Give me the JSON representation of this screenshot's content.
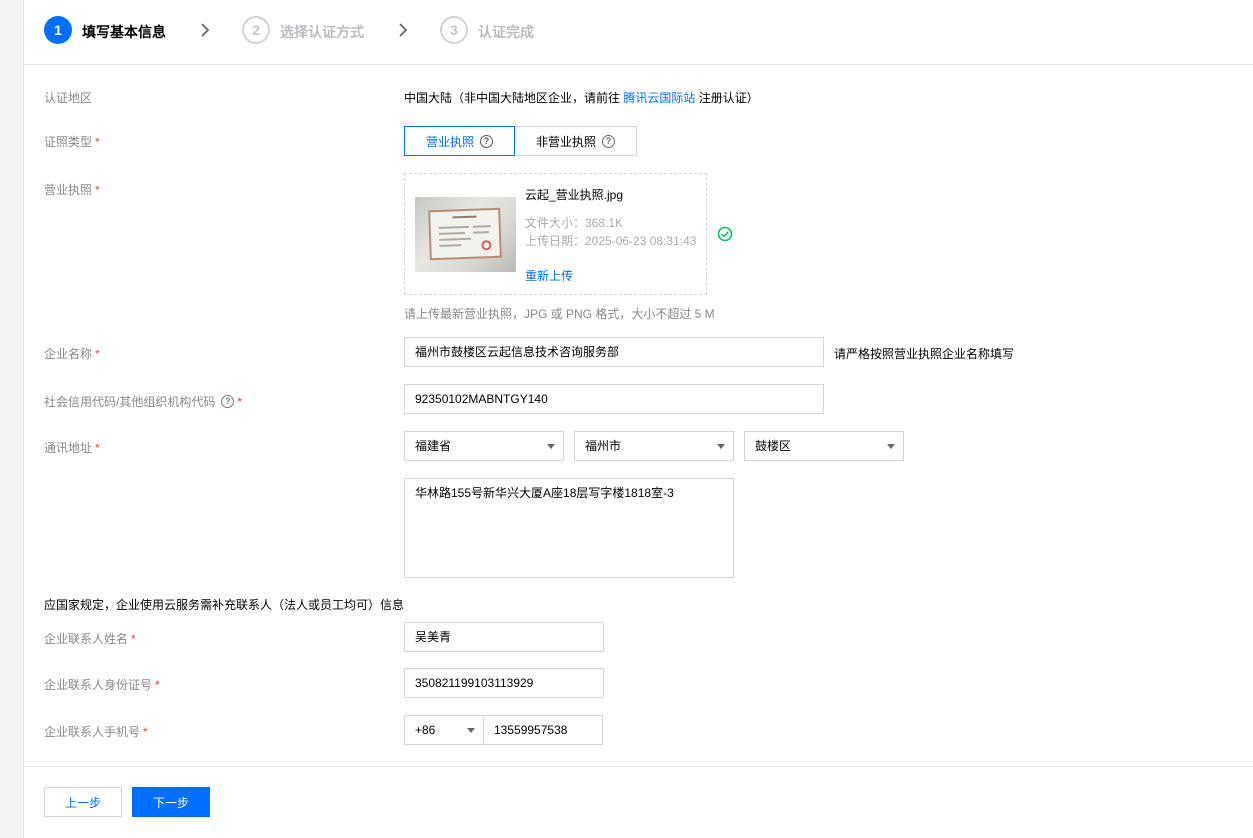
{
  "steps": [
    {
      "num": "1",
      "label": "填写基本信息"
    },
    {
      "num": "2",
      "label": "选择认证方式"
    },
    {
      "num": "3",
      "label": "认证完成"
    }
  ],
  "region": {
    "label": "认证地区",
    "prefix": "中国大陆（非中国大陆地区企业，请前往 ",
    "link": "腾讯云国际站",
    "suffix": " 注册认证）"
  },
  "license_type": {
    "label": "证照类型",
    "required": "*",
    "options": [
      "营业执照",
      "非营业执照"
    ],
    "help_icon": "?"
  },
  "license": {
    "label": "营业执照",
    "required": "*",
    "file_name": "云起_营业执照.jpg",
    "file_size": "文件大小：368.1K",
    "upload_date": "上传日期：2025-06-23 08:31:43",
    "reupload": "重新上传",
    "hint": "请上传最新营业执照，JPG 或 PNG 格式，大小不超过 5 M"
  },
  "company_name": {
    "label": "企业名称",
    "required": "*",
    "value": "福州市鼓楼区云起信息技术咨询服务部",
    "hint": "请严格按照营业执照企业名称填写"
  },
  "credit_code": {
    "label": "社会信用代码/其他组织机构代码",
    "required": "*",
    "value": "92350102MABNTGY140"
  },
  "address": {
    "label": "通讯地址",
    "required": "*",
    "province": "福建省",
    "city": "福州市",
    "district": "鼓楼区",
    "detail": "华林路155号新华兴大厦A座18层写字楼1818室-3"
  },
  "contact_notice": "应国家规定，企业使用云服务需补充联系人（法人或员工均可）信息",
  "contact": {
    "name_label": "企业联系人姓名",
    "name_value": "吴美青",
    "id_label": "企业联系人身份证号",
    "id_value": "350821199103113929",
    "phone_label": "企业联系人手机号",
    "phone_code": "+86",
    "phone_value": "13559957538",
    "required": "*"
  },
  "buttons": {
    "prev": "上一步",
    "next": "下一步"
  },
  "colors": {
    "primary": "#006eff",
    "success": "#0abf5b",
    "required": "#e54545"
  }
}
